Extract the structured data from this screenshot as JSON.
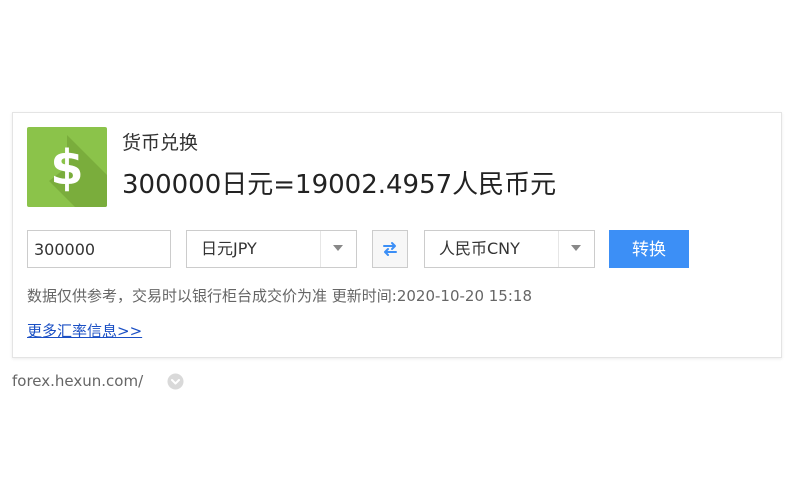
{
  "converter": {
    "title": "货币兑换",
    "result": "300000日元=19002.4957人民币元",
    "amount_value": "300000",
    "from_currency": "日元JPY",
    "to_currency": "人民币CNY",
    "convert_label": "转换",
    "disclaimer": "数据仅供参考，交易时以银行柜台成交价为准 更新时间:2020-10-20 15:18",
    "more_link": "更多汇率信息>>",
    "logo_icon": "dollar-sign-icon",
    "swap_icon": "swap-arrows-icon"
  },
  "source": {
    "url": "forex.hexun.com/",
    "dropdown_icon": "chevron-down-circle-icon"
  },
  "colors": {
    "logo_green": "#8bc34a",
    "button_blue": "#3c8ff6",
    "link_blue": "#1a4fc4",
    "swap_icon_blue": "#3c8ff6"
  }
}
